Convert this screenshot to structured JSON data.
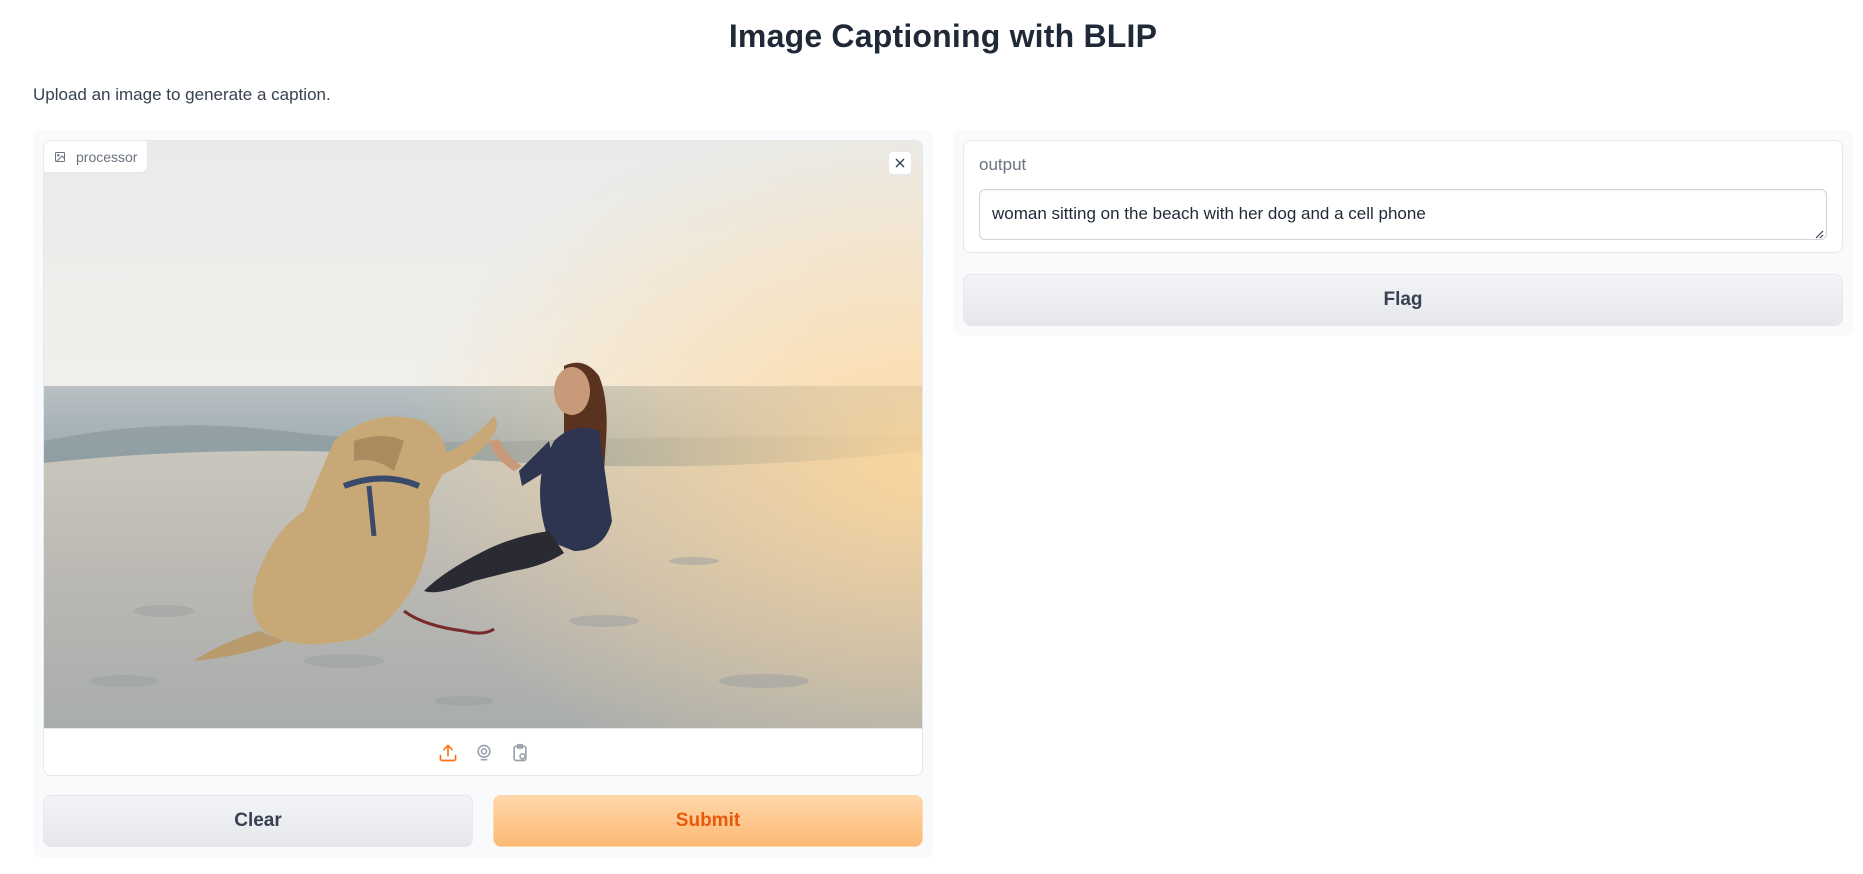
{
  "header": {
    "title": "Image Captioning with BLIP",
    "description": "Upload an image to generate a caption."
  },
  "input_image": {
    "label": "processor",
    "photo_alt": "woman and dog on a beach",
    "sources": [
      "upload-icon",
      "webcam-icon",
      "clipboard-icon"
    ]
  },
  "actions": {
    "clear_label": "Clear",
    "submit_label": "Submit",
    "flag_label": "Flag"
  },
  "output": {
    "label": "output",
    "value": "woman sitting on the beach with her dog and a cell phone"
  },
  "colors": {
    "accent": "#f97316",
    "submit_bg": "#fdba74",
    "submit_text": "#ea580c",
    "neutral_btn": "#e5e7eb"
  }
}
